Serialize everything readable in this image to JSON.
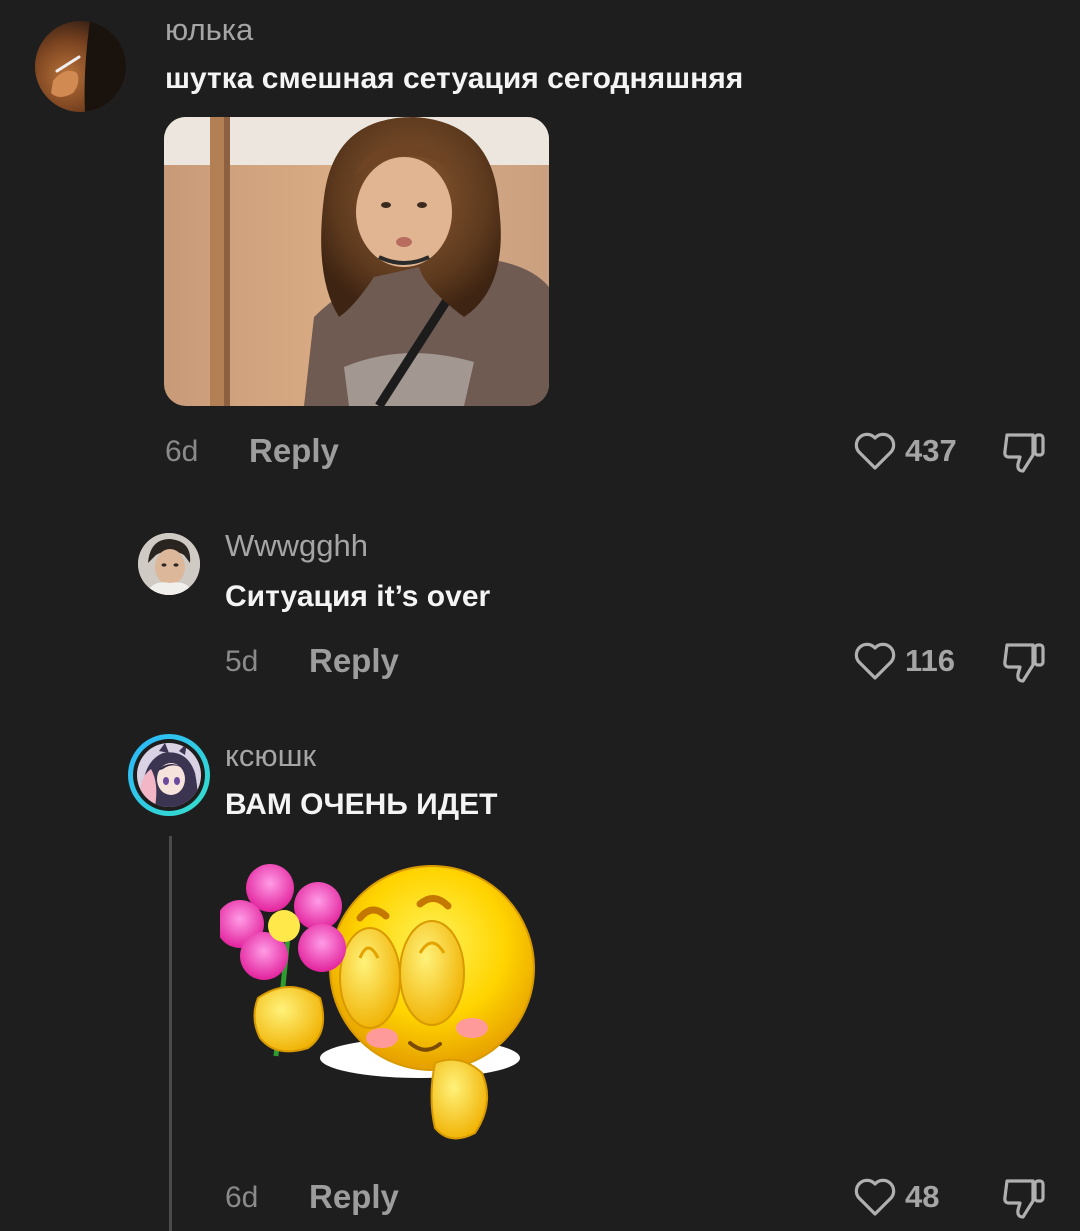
{
  "comments": [
    {
      "username": "юлька",
      "text": "шутка смешная сетуация сегодняшняя",
      "time": "6d",
      "reply_label": "Reply",
      "likes": "437",
      "has_photo": true,
      "avatar_icon": "hand-with-cigarette"
    },
    {
      "username": "Wwwgghh",
      "text": "Ситуация it’s over",
      "time": "5d",
      "reply_label": "Reply",
      "likes": "116",
      "avatar_icon": "man-portrait"
    },
    {
      "username": "ксюшк",
      "text": "ВАМ ОЧЕНЬ ИДЕТ",
      "time": "6d",
      "reply_label": "Reply",
      "likes": "48",
      "has_sticker": true,
      "avatar_icon": "anime-girl",
      "avatar_ring_colors": [
        "#2bb6ff",
        "#35e0c8"
      ]
    }
  ],
  "colors": {
    "background": "#1e1e1e",
    "username": "#a5a5a5",
    "text": "#f4f4f4",
    "meta": "#9d9d9d"
  }
}
